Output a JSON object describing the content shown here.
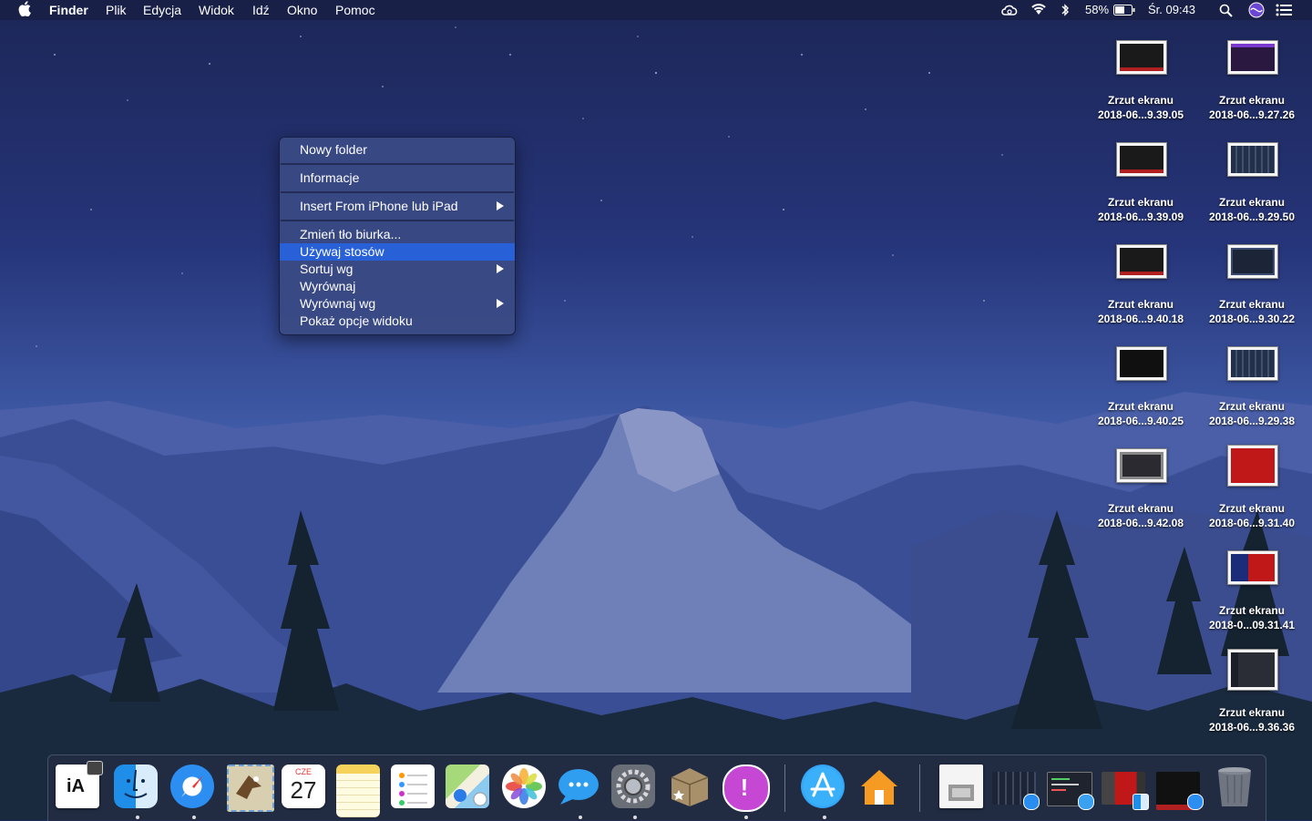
{
  "menubar": {
    "app_name": "Finder",
    "menus": [
      "Plik",
      "Edycja",
      "Widok",
      "Idź",
      "Okno",
      "Pomoc"
    ],
    "battery": "58%",
    "clock": "Śr. 09:43",
    "status_icons": [
      "creative-cloud-icon",
      "wifi-icon",
      "bluetooth-icon",
      "battery-icon",
      "spotlight-search-icon",
      "siri-icon",
      "notification-center-icon"
    ]
  },
  "context_menu": {
    "items": [
      {
        "label": "Nowy folder",
        "submenu": false,
        "highlighted": false
      },
      {
        "label": "Informacje",
        "submenu": false,
        "highlighted": false
      },
      {
        "label": "Insert From iPhone lub iPad",
        "submenu": true,
        "highlighted": false
      },
      {
        "label": "Zmień tło biurka...",
        "submenu": false,
        "highlighted": false
      },
      {
        "label": "Używaj stosów",
        "submenu": false,
        "highlighted": true
      },
      {
        "label": "Sortuj wg",
        "submenu": true,
        "highlighted": false
      },
      {
        "label": "Wyrównaj",
        "submenu": false,
        "highlighted": false
      },
      {
        "label": "Wyrównaj wg",
        "submenu": true,
        "highlighted": false
      },
      {
        "label": "Pokaż opcje widoku",
        "submenu": false,
        "highlighted": false
      }
    ],
    "highlight_color": "#2860d8"
  },
  "desktop_files": [
    {
      "line1": "Zrzut ekranu",
      "line2": "2018-06...9.39.05",
      "thumb": "dark"
    },
    {
      "line1": "Zrzut ekranu",
      "line2": "2018-06...9.27.26",
      "thumb": "purple"
    },
    {
      "line1": "Zrzut ekranu",
      "line2": "2018-06...9.39.09",
      "thumb": "dark"
    },
    {
      "line1": "Zrzut ekranu",
      "line2": "2018-06...9.29.50",
      "thumb": "grid"
    },
    {
      "line1": "Zrzut ekranu",
      "line2": "2018-06...9.40.18",
      "thumb": "dark"
    },
    {
      "line1": "Zrzut ekranu",
      "line2": "2018-06...9.30.22",
      "thumb": "grid"
    },
    {
      "line1": "Zrzut ekranu",
      "line2": "2018-06...9.40.25",
      "thumb": "text"
    },
    {
      "line1": "Zrzut ekranu",
      "line2": "2018-06...9.29.38",
      "thumb": "grid"
    },
    {
      "line1": "Zrzut ekranu",
      "line2": "2018-06...9.42.08",
      "thumb": "window"
    },
    {
      "line1": "Zrzut ekranu",
      "line2": "2018-06...9.31.40",
      "thumb": "red"
    },
    {
      "line1": "Zrzut ekranu",
      "line2": "2018-0...09.31.41",
      "thumb": "red-blue"
    },
    {
      "line1": "Zrzut ekranu",
      "line2": "2018-06...9.36.36",
      "thumb": "code"
    }
  ],
  "dock": {
    "calendar_month": "CZE",
    "calendar_day": "27",
    "ia_writer_label": "iA",
    "apps": [
      {
        "name": "ia-writer-icon",
        "running": false
      },
      {
        "name": "finder-icon",
        "running": true
      },
      {
        "name": "safari-icon",
        "running": true
      },
      {
        "name": "mail-icon",
        "running": false
      },
      {
        "name": "calendar-icon",
        "running": false
      },
      {
        "name": "notes-icon",
        "running": false
      },
      {
        "name": "reminders-icon",
        "running": false
      },
      {
        "name": "maps-icon",
        "running": false
      },
      {
        "name": "photos-icon",
        "running": false
      },
      {
        "name": "messages-icon",
        "running": true
      },
      {
        "name": "system-preferences-icon",
        "running": true
      },
      {
        "name": "app-package-icon",
        "running": false
      },
      {
        "name": "feedback-assistant-icon",
        "running": true
      },
      {
        "name": "app-store-icon",
        "running": true
      },
      {
        "name": "home-icon",
        "running": false
      },
      {
        "name": "preview-document-icon",
        "running": false
      },
      {
        "name": "stack-app-store-icon",
        "running": false
      },
      {
        "name": "stack-messages-icon",
        "running": false
      },
      {
        "name": "stack-finder-icon",
        "running": false
      },
      {
        "name": "stack-safari-icon",
        "running": false
      },
      {
        "name": "trash-icon",
        "running": false
      }
    ]
  }
}
